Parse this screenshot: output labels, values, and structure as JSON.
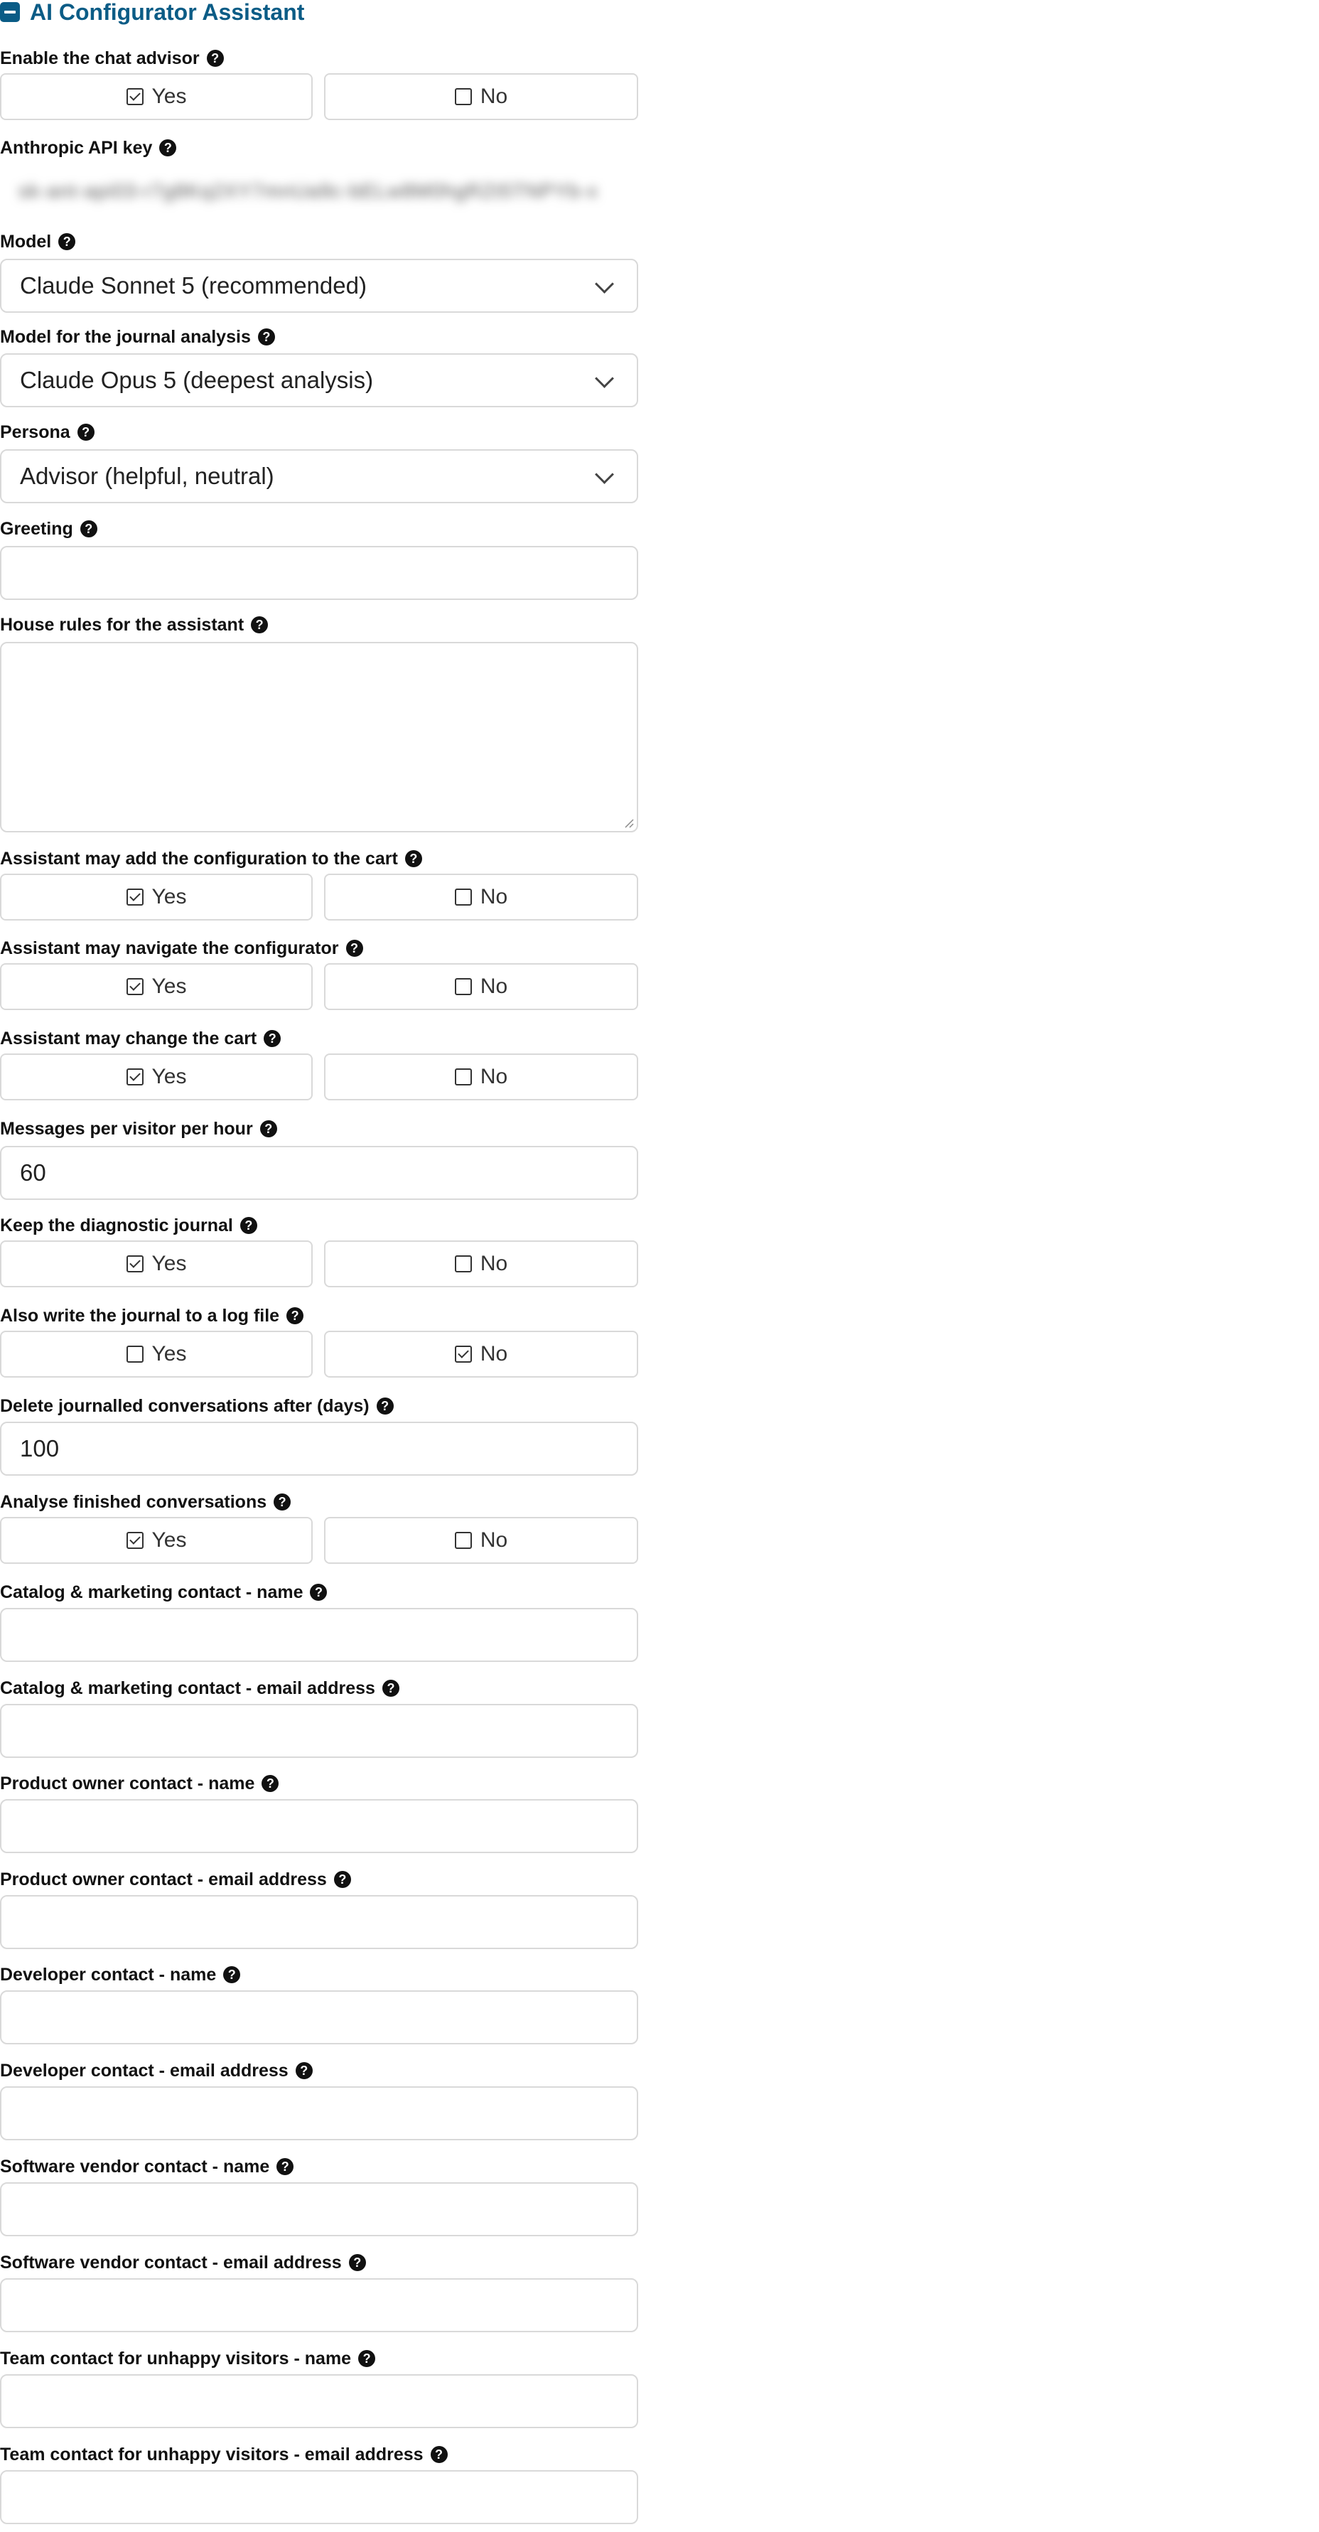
{
  "section": {
    "title": "AI Configurator Assistant",
    "icon": "collapse-icon"
  },
  "help_glyph": "?",
  "toggle_labels": {
    "yes": "Yes",
    "no": "No"
  },
  "fields": {
    "enable_chat": {
      "label": "Enable the chat advisor",
      "value": "Yes"
    },
    "api_key": {
      "label": "Anthropic API key",
      "value": "sk-ant-api03-r7g8Kq2XY7mnUa9c-bELw8M0hgRZt5TNPYb-x"
    },
    "model": {
      "label": "Model",
      "value": "Claude Sonnet 5 (recommended)"
    },
    "journal_model": {
      "label": "Model for the journal analysis",
      "value": "Claude Opus 5 (deepest analysis)"
    },
    "persona": {
      "label": "Persona",
      "value": "Advisor (helpful, neutral)"
    },
    "greeting": {
      "label": "Greeting",
      "value": ""
    },
    "house_rules": {
      "label": "House rules for the assistant",
      "value": ""
    },
    "may_add_to_cart": {
      "label": "Assistant may add the configuration to the cart",
      "value": "Yes"
    },
    "may_navigate": {
      "label": "Assistant may navigate the configurator",
      "value": "Yes"
    },
    "may_change_cart": {
      "label": "Assistant may change the cart",
      "value": "Yes"
    },
    "messages_per_hour": {
      "label": "Messages per visitor per hour",
      "value": "60"
    },
    "keep_journal": {
      "label": "Keep the diagnostic journal",
      "value": "Yes"
    },
    "journal_log_file": {
      "label": "Also write the journal to a log file",
      "value": "No"
    },
    "delete_after_days": {
      "label": "Delete journalled conversations after (days)",
      "value": "100"
    },
    "analyse_finished": {
      "label": "Analyse finished conversations",
      "value": "Yes"
    },
    "catalog_contact_name": {
      "label": "Catalog & marketing contact - name",
      "value": ""
    },
    "catalog_contact_email": {
      "label": "Catalog & marketing contact - email address",
      "value": ""
    },
    "owner_contact_name": {
      "label": "Product owner contact - name",
      "value": ""
    },
    "owner_contact_email": {
      "label": "Product owner contact - email address",
      "value": ""
    },
    "developer_contact_name": {
      "label": "Developer contact - name",
      "value": ""
    },
    "developer_contact_email": {
      "label": "Developer contact - email address",
      "value": ""
    },
    "vendor_contact_name": {
      "label": "Software vendor contact - name",
      "value": ""
    },
    "vendor_contact_email": {
      "label": "Software vendor contact - email address",
      "value": ""
    },
    "team_contact_name": {
      "label": "Team contact for unhappy visitors - name",
      "value": ""
    },
    "team_contact_email": {
      "label": "Team contact for unhappy visitors - email address",
      "value": ""
    }
  }
}
